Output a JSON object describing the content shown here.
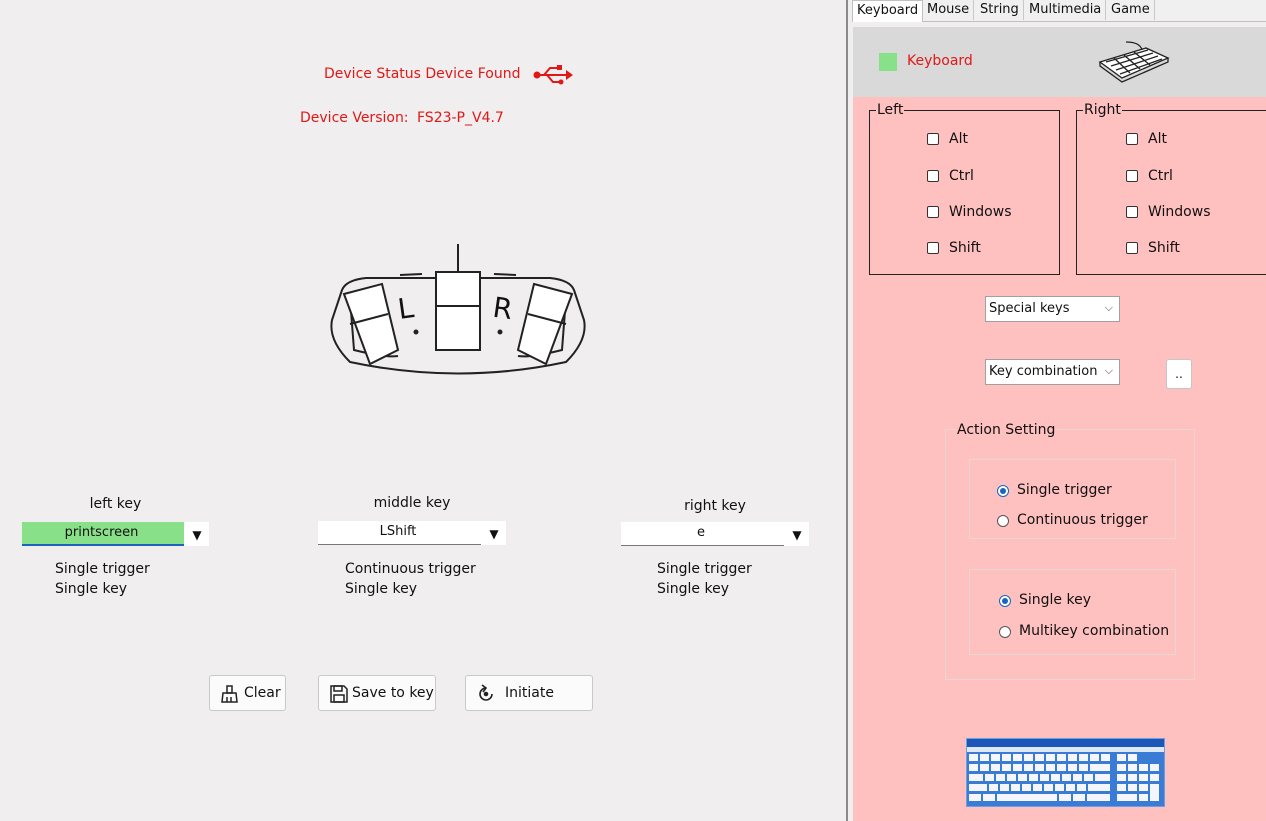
{
  "status": {
    "label": "Device Status Device Found",
    "icon": "usb-icon"
  },
  "version": {
    "label": "Device Version:",
    "value": "FS23-P_V4.7"
  },
  "pedal": {
    "left_letter": "L",
    "right_letter": "R"
  },
  "keys": [
    {
      "title": "left key",
      "value": "printscreen",
      "trigger": "Single trigger",
      "mode": "Single key"
    },
    {
      "title": "middle key",
      "value": "LShift",
      "trigger": "Continuous trigger",
      "mode": "Single key"
    },
    {
      "title": "right key",
      "value": "e",
      "trigger": "Single trigger",
      "mode": "Single key"
    }
  ],
  "buttons": {
    "clear": "Clear",
    "save": "Save to key",
    "initiate": "Initiate"
  },
  "tabs": [
    "Keyboard",
    "Mouse",
    "String",
    "Multimedia",
    "Game"
  ],
  "panel": {
    "header": "Keyboard",
    "left_group": {
      "title": "Left",
      "items": [
        "Alt",
        "Ctrl",
        "Windows",
        "Shift"
      ]
    },
    "right_group": {
      "title": "Right",
      "items": [
        "Alt",
        "Ctrl",
        "Windows",
        "Shift"
      ]
    },
    "special_keys": "Special keys",
    "key_combination": "Key combination",
    "dots": "..",
    "action_setting": {
      "title": "Action Setting",
      "trigger_options": [
        "Single trigger",
        "Continuous trigger"
      ],
      "trigger_selected": 0,
      "key_options": [
        "Single key",
        "Multikey  combination"
      ],
      "key_selected": 0
    }
  },
  "colors": {
    "status_red": "#e01818",
    "active_green": "#88e088",
    "panel_pink": "#ffc0c0",
    "accent_blue": "#1a64c0"
  }
}
